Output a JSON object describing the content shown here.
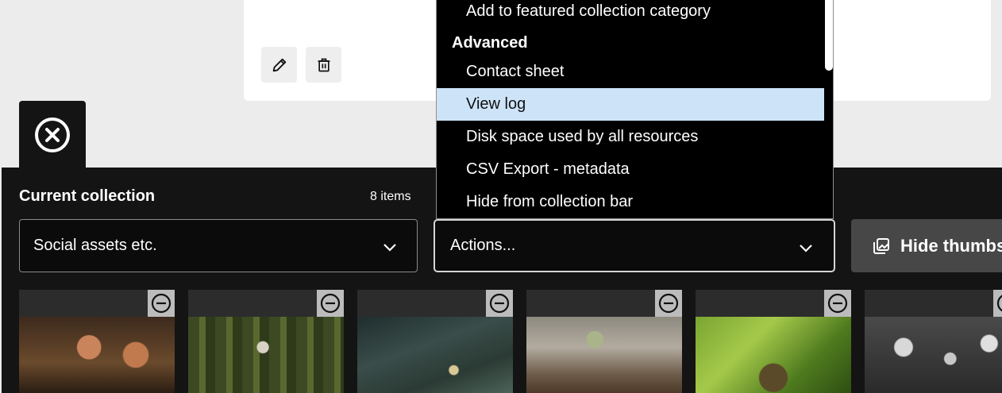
{
  "header_card": {
    "edit_icon": "pencil-icon",
    "delete_icon": "trash-icon"
  },
  "close_tab": {
    "icon": "close-circle-icon"
  },
  "collection_bar": {
    "title": "Current collection",
    "items_count": "8 items",
    "collection_select": {
      "value": "Social assets etc."
    },
    "actions_select": {
      "value": "Actions...",
      "options": {
        "featured": "Add to featured collection category",
        "group_advanced": "Advanced",
        "contact_sheet": "Contact sheet",
        "view_log": "View log",
        "disk_space": "Disk space used by all resources",
        "csv_export": "CSV Export - metadata",
        "hide_bar": "Hide from collection bar"
      },
      "selected_option": "View log"
    },
    "hide_thumbs_label": "Hide thumbs"
  },
  "thumbnails": [
    {
      "subject": "orange mushrooms",
      "remove_icon": "minus-circle-icon"
    },
    {
      "subject": "forest mushroom",
      "remove_icon": "minus-circle-icon"
    },
    {
      "subject": "moss and mushroom",
      "remove_icon": "minus-circle-icon"
    },
    {
      "subject": "mushroom on log",
      "remove_icon": "minus-circle-icon"
    },
    {
      "subject": "mossy tree",
      "remove_icon": "minus-circle-icon"
    },
    {
      "subject": "white mushrooms",
      "remove_icon": "minus-circle-icon"
    }
  ],
  "colors": {
    "bar_background": "#141414",
    "highlight": "#cde3f8",
    "page_background": "#ececec"
  }
}
